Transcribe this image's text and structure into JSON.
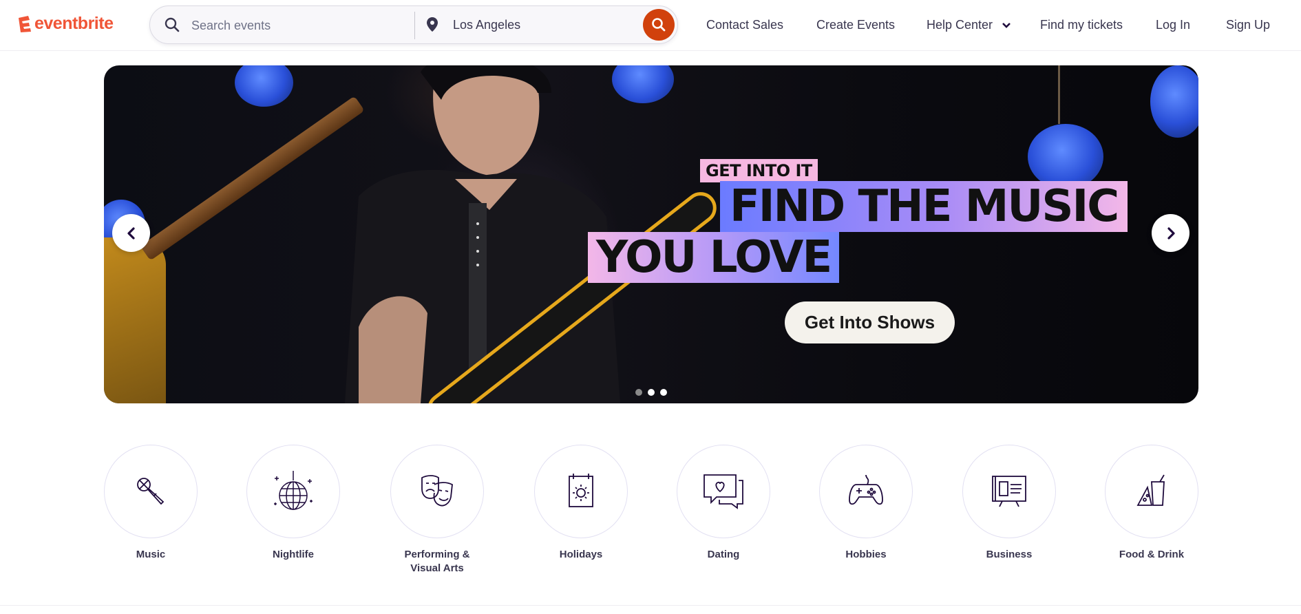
{
  "brand": {
    "name": "eventbrite",
    "color": "#f05537"
  },
  "search": {
    "placeholder": "Search events",
    "location": "Los Angeles",
    "submit_icon": "search-icon",
    "accent": "#d1410c"
  },
  "nav": {
    "contact_sales": "Contact Sales",
    "create_events": "Create Events",
    "help_center": "Help Center",
    "find_tickets": "Find my tickets",
    "log_in": "Log In",
    "sign_up": "Sign Up"
  },
  "hero": {
    "kicker": "GET INTO IT",
    "headline_line1": "FIND THE MUSIC",
    "headline_line2": "YOU LOVE",
    "cta": "Get Into Shows",
    "prev_icon": "chevron-left-icon",
    "next_icon": "chevron-right-icon",
    "slides": 3
  },
  "categories": [
    {
      "label": "Music",
      "icon": "microphone-icon"
    },
    {
      "label": "Nightlife",
      "icon": "disco-ball-icon"
    },
    {
      "label": "Performing & Visual Arts",
      "icon": "theater-masks-icon"
    },
    {
      "label": "Holidays",
      "icon": "calendar-sun-icon"
    },
    {
      "label": "Dating",
      "icon": "chat-heart-icon"
    },
    {
      "label": "Hobbies",
      "icon": "gamepad-icon"
    },
    {
      "label": "Business",
      "icon": "presentation-board-icon"
    },
    {
      "label": "Food & Drink",
      "icon": "food-drink-icon"
    }
  ]
}
